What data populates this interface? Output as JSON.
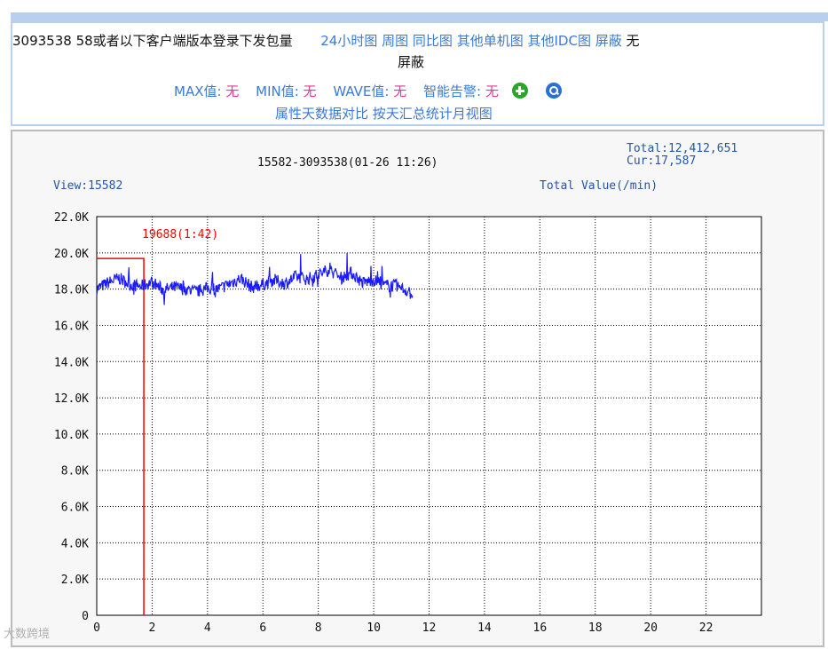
{
  "header": {
    "title": "3093538 58或者以下客户端版本登录下发包量",
    "links": [
      "24小时图",
      "周图",
      "同比图",
      "其他单机图",
      "其他IDC图",
      "屏蔽"
    ],
    "shield_tail_a": "无",
    "shield_tail_b": "屏蔽",
    "max_label": "MAX值:",
    "max_value": "无",
    "min_label": "MIN值:",
    "min_value": "无",
    "wave_label": "WAVE值:",
    "wave_value": "无",
    "alert_label": "智能告警:",
    "alert_value": "无",
    "add_icon": "plus-circle-icon",
    "zoom_icon": "magnifier-icon",
    "row3_links": [
      "属性天数据对比",
      "按天汇总统计月视图"
    ]
  },
  "watermark": "大数跨境",
  "chart_data": {
    "type": "line",
    "title": "15582-3093538(01-26 11:26)",
    "total": "Total:12,412,651",
    "cur": "Cur:17,587",
    "view_label": "View:15582",
    "value_label": "Total Value(/min)",
    "marker_label": "19688(1:42)",
    "ylim": [
      0,
      22000
    ],
    "xlim": [
      0,
      24
    ],
    "y_ticks": [
      0,
      2000,
      4000,
      6000,
      8000,
      10000,
      12000,
      14000,
      16000,
      18000,
      20000,
      22000
    ],
    "y_tick_labels": [
      "0",
      "2.0K",
      "4.0K",
      "6.0K",
      "8.0K",
      "10.0K",
      "12.0K",
      "14.0K",
      "16.0K",
      "18.0K",
      "20.0K",
      "22.0K"
    ],
    "x_ticks": [
      0,
      2,
      4,
      6,
      8,
      10,
      12,
      14,
      16,
      18,
      20,
      22
    ],
    "x_tick_labels": [
      "0",
      "2",
      "4",
      "6",
      "8",
      "10",
      "12",
      "14",
      "16",
      "18",
      "20",
      "22"
    ],
    "grid": true,
    "series_color": "#1a1aff",
    "marker_color": "#ff0000",
    "marker": {
      "x": 1.7,
      "y": 19688
    },
    "series": [
      {
        "x": [
          0,
          0.4,
          0.8,
          1.2,
          1.6,
          2.0,
          2.4,
          2.8,
          3.2,
          3.6,
          4.0,
          4.4,
          4.8,
          5.2,
          5.6,
          6.0,
          6.4,
          6.8,
          7.2,
          7.6,
          8.0,
          8.4,
          8.8,
          9.2,
          9.6,
          10.0,
          10.4,
          10.8,
          11.2,
          11.4
        ],
        "y": [
          18000,
          18350,
          18600,
          18250,
          18150,
          18400,
          17950,
          18100,
          18000,
          17850,
          18050,
          18000,
          18300,
          18600,
          18100,
          18250,
          18500,
          18300,
          18700,
          18550,
          18800,
          19100,
          18600,
          18900,
          18350,
          18500,
          18200,
          18200,
          17900,
          17700
        ]
      }
    ]
  }
}
